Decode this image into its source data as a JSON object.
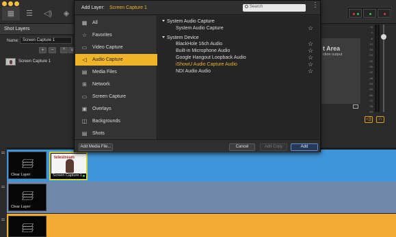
{
  "window": {
    "traffic_light_color": "#f2c043"
  },
  "toolbar": {
    "icons": [
      "layers-icon",
      "sliders-icon",
      "audio-icon",
      "shield-icon"
    ]
  },
  "left_panel": {
    "title": "Shot Layers",
    "name_label": "Name:",
    "name_value": "Screen Capture 1",
    "buttons": [
      "+",
      "−",
      "^",
      "v"
    ],
    "layers": [
      {
        "label": "Screen Capture 1"
      }
    ]
  },
  "dialog": {
    "title": "Add Layer:",
    "source_name": "Screen Capture 1",
    "search_placeholder": "Search",
    "categories": [
      {
        "label": "All",
        "icon": "grid-icon"
      },
      {
        "label": "Favorites",
        "icon": "star-icon"
      },
      {
        "label": "Video Capture",
        "icon": "camera-icon"
      },
      {
        "label": "Audio Capture",
        "icon": "speaker-icon",
        "active": true
      },
      {
        "label": "Media Files",
        "icon": "film-icon"
      },
      {
        "label": "Network",
        "icon": "network-icon"
      },
      {
        "label": "Screen Capture",
        "icon": "monitor-icon"
      },
      {
        "label": "Overlays",
        "icon": "overlay-icon"
      },
      {
        "label": "Backgrounds",
        "icon": "backgrounds-icon"
      },
      {
        "label": "Shots",
        "icon": "shots-icon"
      }
    ],
    "groups": [
      {
        "label": "System Audio Capture",
        "items": [
          {
            "label": "System Audio Capture",
            "highlight": false
          }
        ]
      },
      {
        "label": "System Device",
        "items": [
          {
            "label": "BlackHole 16ch Audio",
            "highlight": false
          },
          {
            "label": "Built-in Microphone Audio",
            "highlight": false
          },
          {
            "label": "Google Hangout Loopback Audio",
            "highlight": false
          },
          {
            "label": "iShowU Audio Capture Audio",
            "highlight": true
          },
          {
            "label": "NDI Audio Audio",
            "highlight": false
          }
        ]
      }
    ],
    "footer": {
      "add_media_label": "Add Media File...",
      "cancel_label": "Cancel",
      "add_copy_label": "Add Copy",
      "add_label": "Add"
    }
  },
  "preview": {
    "title": "t Area",
    "subtitle": "ction output"
  },
  "meter": {
    "scale": [
      "+6",
      "0",
      "-6",
      "-12",
      "-18",
      "-24",
      "-30",
      "-36",
      "-42",
      "-48",
      "-54",
      "-60",
      "-66",
      "-72",
      "-78",
      "-84"
    ]
  },
  "timeline": {
    "tracks": [
      {
        "color": "#3e95d9",
        "cells": [
          {
            "label": "Clear Layer",
            "kind": "clear"
          },
          {
            "label": "Screen Capture 1",
            "kind": "capture",
            "selected": true,
            "thumb_brand": "telestream"
          }
        ]
      },
      {
        "color": "#6f87a8",
        "cells": [
          {
            "label": "Clear Layer",
            "kind": "clear"
          }
        ]
      },
      {
        "color": "#f2ac35",
        "cells": [
          {
            "label": "",
            "kind": "clear"
          }
        ]
      }
    ]
  }
}
